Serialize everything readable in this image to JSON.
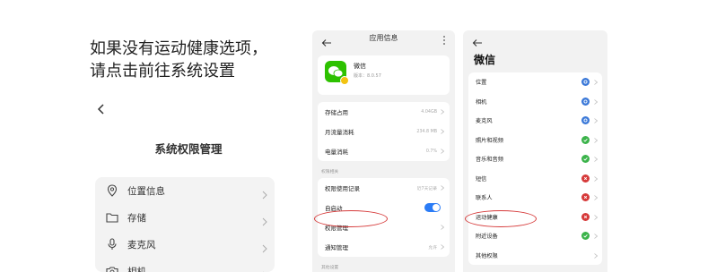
{
  "instruction": {
    "line1": "如果没有运动健康选项，",
    "line2": "请点击前往系统设置"
  },
  "system_panel": {
    "title": "系统权限管理",
    "items": [
      {
        "label": "位置信息",
        "icon": "location-icon"
      },
      {
        "label": "存储",
        "icon": "folder-icon"
      },
      {
        "label": "麦克风",
        "icon": "microphone-icon"
      },
      {
        "label": "相机",
        "icon": "camera-icon"
      }
    ]
  },
  "app_info": {
    "title": "应用信息",
    "app_name": "微信",
    "app_version": "版本：8.0.57",
    "usage_rows": [
      {
        "label": "存储占用",
        "value": "4.04GB"
      },
      {
        "label": "月流量消耗",
        "value": "234.8 MB"
      },
      {
        "label": "电量消耗",
        "value": "0.7%"
      }
    ],
    "permission_section": "权限相关",
    "permission_rows": [
      {
        "label": "权限使用记录",
        "value": "近7天记录"
      },
      {
        "label": "自启动",
        "value": ""
      },
      {
        "label": "权限管理",
        "value": ""
      },
      {
        "label": "通知管理",
        "value": "允许"
      }
    ],
    "other_section": "其他设置"
  },
  "wechat_permissions": {
    "title": "微信",
    "rows": [
      {
        "label": "位置",
        "status": "ask"
      },
      {
        "label": "相机",
        "status": "ask"
      },
      {
        "label": "麦克风",
        "status": "ask"
      },
      {
        "label": "照片和视频",
        "status": "allowed"
      },
      {
        "label": "音乐和音频",
        "status": "allowed"
      },
      {
        "label": "短信",
        "status": "denied"
      },
      {
        "label": "联系人",
        "status": "denied"
      },
      {
        "label": "运动健康",
        "status": "denied"
      },
      {
        "label": "附近设备",
        "status": "allowed"
      },
      {
        "label": "其他权限",
        "status": ""
      }
    ]
  },
  "colors": {
    "accent_blue": "#2b7cf6",
    "allowed_green": "#3bb34a",
    "denied_red": "#d63a3a",
    "ask_blue": "#3a78d8",
    "wechat_green": "#2dc100",
    "highlight_oval": "#d63a3a"
  }
}
